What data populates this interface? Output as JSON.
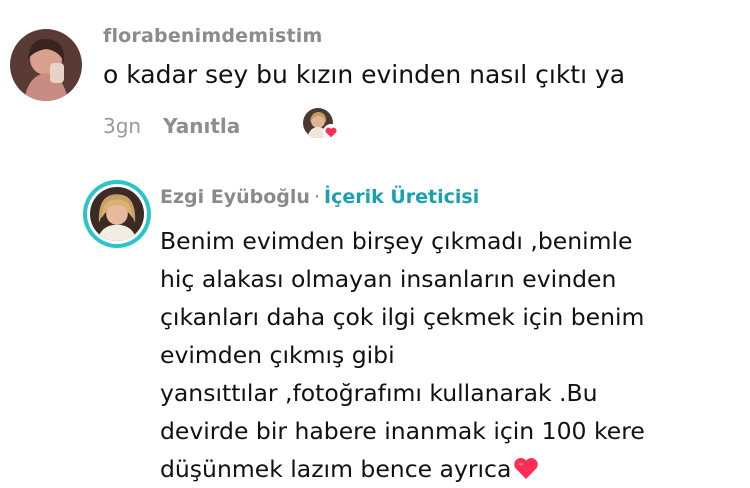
{
  "comment1": {
    "username": "florabenimdemistim",
    "text": "o kadar sey bu kızın evinden nasıl çıktı ya",
    "time": "3gn",
    "reply_label": "Yanıtla"
  },
  "comment2": {
    "username": "Ezgi Eyüboğlu",
    "separator": "·",
    "role": "İçerik Üreticisi",
    "lines": [
      "Benim evimden birşey çıkmadı ,benimle",
      "hiç alakası olmayan insanların evinden",
      "çıkanları daha çok ilgi çekmek için benim",
      "evimden çıkmış gibi",
      "yansıttılar ,fotoğrafımı kullanarak .Bu",
      "devirde bir habere inanmak için 100 kere",
      "düşünmek lazım bence ayrıca"
    ]
  },
  "colors": {
    "role_accent": "#1aa1b0",
    "ring": "#2bc4c9",
    "heart": "#ff2d55"
  }
}
